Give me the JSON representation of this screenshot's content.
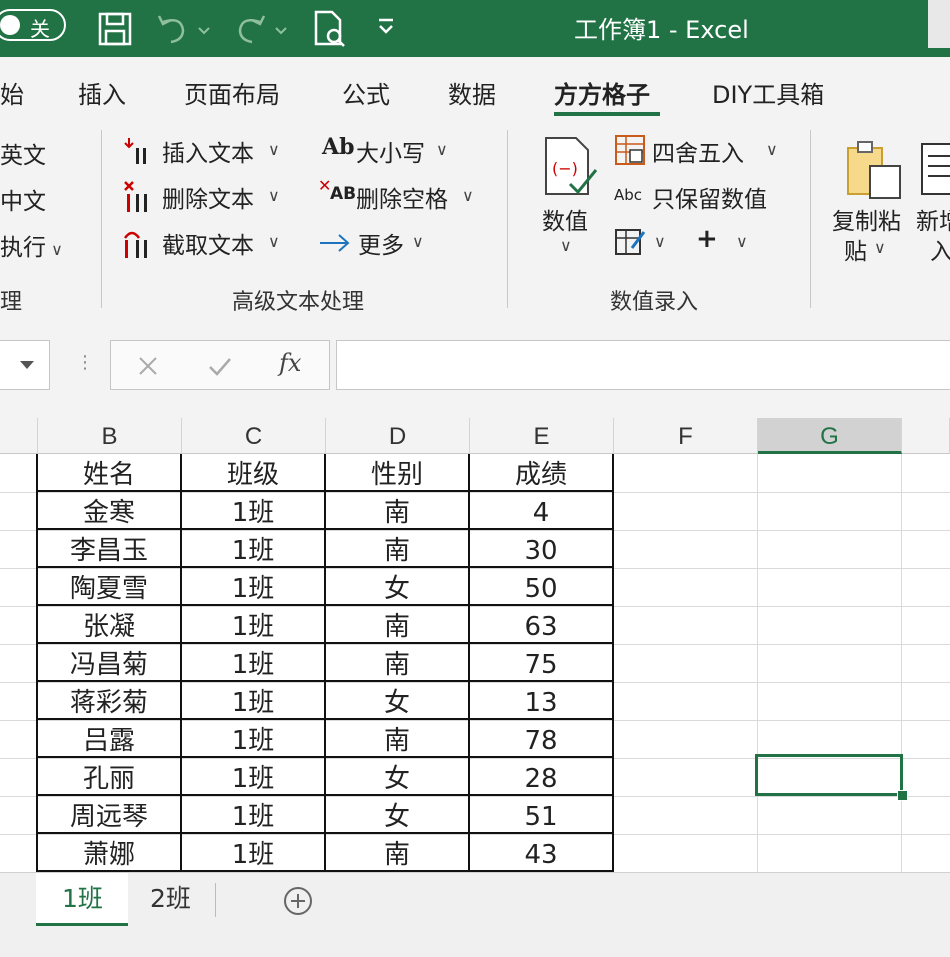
{
  "titlebar": {
    "autosave_label": "关",
    "title": "工作簿1  -  Excel"
  },
  "ribbon_tabs": [
    {
      "label": "始"
    },
    {
      "label": "插入"
    },
    {
      "label": "页面布局"
    },
    {
      "label": "公式"
    },
    {
      "label": "数据"
    },
    {
      "label": "方方格子",
      "active": true
    },
    {
      "label": "DIY工具箱"
    }
  ],
  "ribbon": {
    "left_items": [
      "英文",
      "中文",
      "执行"
    ],
    "left_group_label": "理",
    "text_group": {
      "insert_text": "插入文本",
      "delete_text": "删除文本",
      "extract_text": "截取文本",
      "case": "大小写",
      "delete_space": "删除空格",
      "more": "更多",
      "label": "高级文本处理"
    },
    "value_group": {
      "value_button": "数值",
      "round": "四舍五入",
      "keep_numbers": "只保留数值",
      "label": "数值录入"
    },
    "copy_paste": "复制粘",
    "copy_paste_2": "贴",
    "new_button": "新增",
    "new_button_2": "入"
  },
  "formula_bar": {
    "fx_label": "fx",
    "value": ""
  },
  "columns": [
    "B",
    "C",
    "D",
    "E",
    "F",
    "G"
  ],
  "table": {
    "headers": [
      "姓名",
      "班级",
      "性别",
      "成绩"
    ],
    "rows": [
      [
        "金寒",
        "1班",
        "南",
        "4"
      ],
      [
        "李昌玉",
        "1班",
        "南",
        "30"
      ],
      [
        "陶夏雪",
        "1班",
        "女",
        "50"
      ],
      [
        "张凝",
        "1班",
        "南",
        "63"
      ],
      [
        "冯昌菊",
        "1班",
        "南",
        "75"
      ],
      [
        "蒋彩菊",
        "1班",
        "女",
        "13"
      ],
      [
        "吕露",
        "1班",
        "南",
        "78"
      ],
      [
        "孔丽",
        "1班",
        "女",
        "28"
      ],
      [
        "周远琴",
        "1班",
        "女",
        "51"
      ],
      [
        "萧娜",
        "1班",
        "南",
        "43"
      ]
    ]
  },
  "sheets": [
    {
      "label": "1班",
      "active": true
    },
    {
      "label": "2班"
    }
  ],
  "colors": {
    "accent": "#217346"
  }
}
